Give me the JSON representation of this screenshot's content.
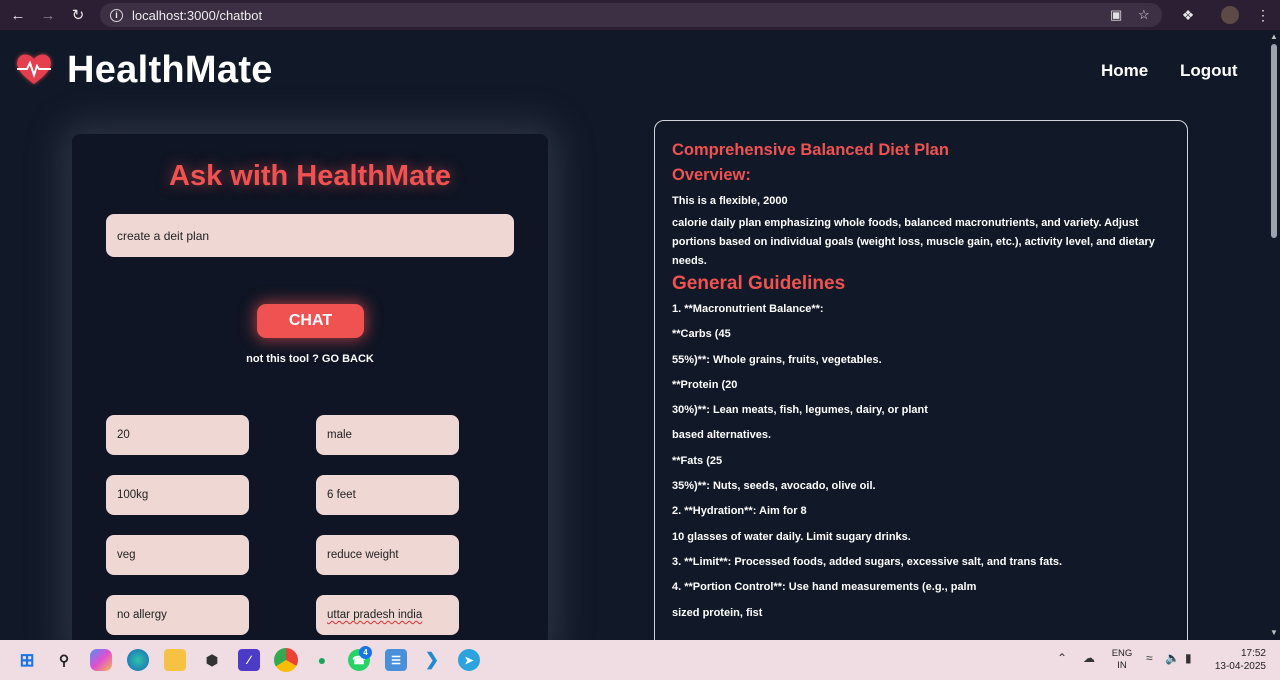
{
  "browser": {
    "url": "localhost:3000/chatbot"
  },
  "header": {
    "title": "HealthMate",
    "nav": [
      {
        "label": "Home"
      },
      {
        "label": "Logout"
      }
    ]
  },
  "chat": {
    "heading": "Ask with HealthMate",
    "query_value": "create a deit plan",
    "chat_button": "CHAT",
    "go_back": "not this tool ? GO BACK",
    "fields": [
      {
        "value": "20"
      },
      {
        "value": "male"
      },
      {
        "value": "100kg"
      },
      {
        "value": "6 feet"
      },
      {
        "value": "veg"
      },
      {
        "value": "reduce weight"
      },
      {
        "value": "no allergy"
      },
      {
        "value": "uttar pradesh india"
      }
    ]
  },
  "result": {
    "title": "Comprehensive Balanced Diet Plan",
    "overview_heading": "Overview:",
    "overview_line1": "This is a flexible, 2000",
    "overview_text": "calorie daily plan emphasizing whole foods, balanced macronutrients, and variety. Adjust portions based on individual goals (weight loss, muscle gain, etc.), activity level, and dietary needs.",
    "guidelines_heading": "General Guidelines",
    "lines": [
      "1. **Macronutrient Balance**:",
      "**Carbs (45",
      "55%)**: Whole grains, fruits, vegetables.",
      "**Protein (20",
      "30%)**: Lean meats, fish, legumes, dairy, or plant",
      "based alternatives.",
      "**Fats (25",
      "35%)**: Nuts, seeds, avocado, olive oil.",
      "2. **Hydration**: Aim for 8",
      "10 glasses of water daily. Limit sugary drinks.",
      "3. **Limit**: Processed foods, added sugars, excessive salt, and trans fats.",
      "4. **Portion Control**: Use hand measurements (e.g., palm",
      "sized protein, fist"
    ]
  },
  "taskbar": {
    "language": "ENG",
    "region": "IN",
    "time": "17:52",
    "date": "13-04-2025",
    "whatsapp_badge": "4"
  },
  "colors": {
    "accent": "#f05252",
    "background": "#111827",
    "input_bg": "#efd7d4"
  }
}
